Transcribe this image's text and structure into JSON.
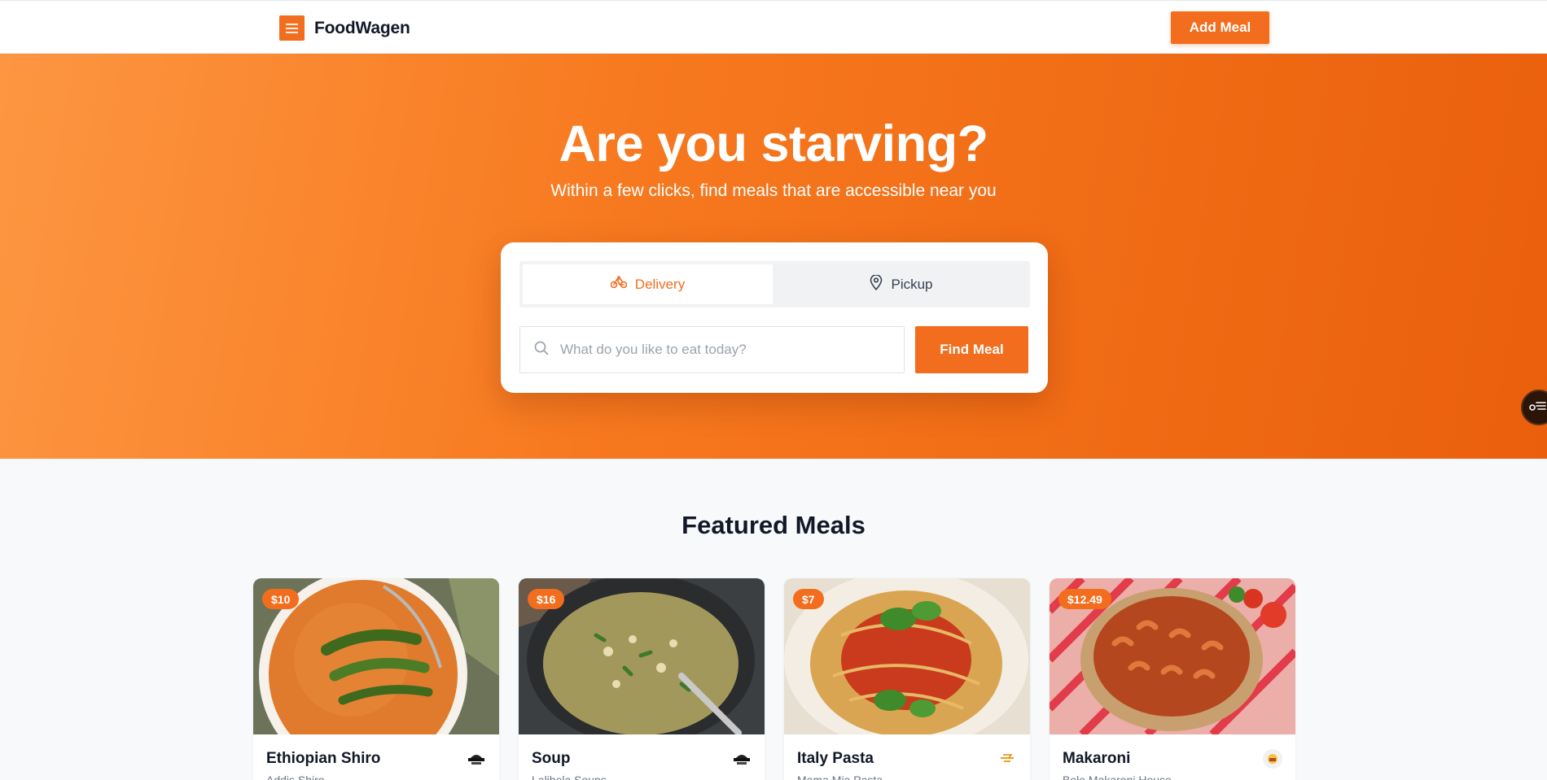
{
  "header": {
    "brand_name": "FoodWagen",
    "add_meal_label": "Add Meal",
    "accent_color": "#f26d1d"
  },
  "hero": {
    "title": "Are you starving?",
    "subtitle": "Within a few clicks, find meals that are accessible near you",
    "tabs": [
      {
        "label": "Delivery",
        "icon": "bike-icon",
        "active": true
      },
      {
        "label": "Pickup",
        "icon": "map-pin-icon",
        "active": false
      }
    ],
    "search": {
      "placeholder": "What do you like to eat today?",
      "value": "",
      "icon": "search-icon"
    },
    "find_meal_label": "Find Meal"
  },
  "featured": {
    "title": "Featured Meals",
    "meals": [
      {
        "price": "$10",
        "name": "Ethiopian Shiro",
        "restaurant": "Addis Shiro"
      },
      {
        "price": "$16",
        "name": "Soup",
        "restaurant": "Lalibela Soups"
      },
      {
        "price": "$7",
        "name": "Italy Pasta",
        "restaurant": "Mama Mia Pasta"
      },
      {
        "price": "$12.49",
        "name": "Makaroni",
        "restaurant": "Bole Makaroni House"
      }
    ]
  }
}
